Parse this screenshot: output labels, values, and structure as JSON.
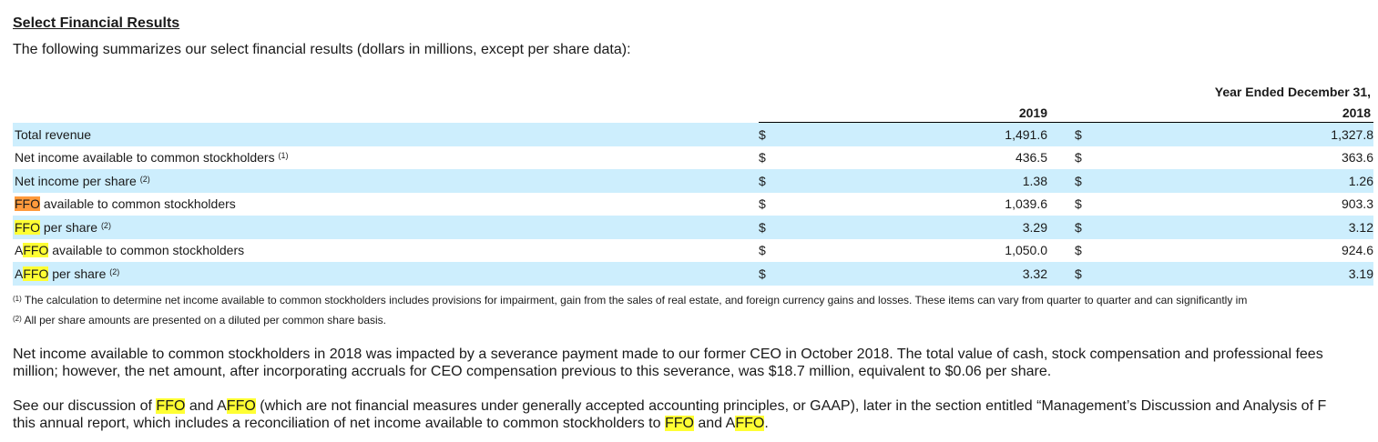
{
  "heading": "Select Financial Results",
  "intro": "The following summarizes our select financial results (dollars in millions, except per share data):",
  "table": {
    "period_header": "Year Ended December 31,",
    "years": [
      "2019",
      "2018"
    ],
    "rows": [
      {
        "pre": "",
        "hl": "",
        "post": "Total revenue",
        "sup": "",
        "cur1": "$",
        "v2019": "1,491.6",
        "cur2": "$",
        "v2018": "1,327.8"
      },
      {
        "pre": "",
        "hl": "",
        "post": "Net income available to common stockholders ",
        "sup": "(1)",
        "cur1": "$",
        "v2019": "436.5",
        "cur2": "$",
        "v2018": "363.6"
      },
      {
        "pre": "",
        "hl": "",
        "post": "Net income per share ",
        "sup": "(2)",
        "cur1": "$",
        "v2019": "1.38",
        "cur2": "$",
        "v2018": "1.26"
      },
      {
        "pre": "",
        "hl": "FFO",
        "post": " available to common stockholders",
        "sup": "",
        "cur1": "$",
        "v2019": "1,039.6",
        "cur2": "$",
        "v2018": "903.3"
      },
      {
        "pre": "",
        "hl": "FFO",
        "post": " per share ",
        "sup": "(2)",
        "cur1": "$",
        "v2019": "3.29",
        "cur2": "$",
        "v2018": "3.12"
      },
      {
        "pre": "A",
        "hl": "FFO",
        "post": " available to common stockholders",
        "sup": "",
        "cur1": "$",
        "v2019": "1,050.0",
        "cur2": "$",
        "v2018": "924.6"
      },
      {
        "pre": "A",
        "hl": "FFO",
        "post": " per share ",
        "sup": "(2)",
        "cur1": "$",
        "v2019": "3.32",
        "cur2": "$",
        "v2018": "3.19"
      }
    ]
  },
  "footnotes": [
    {
      "mark": "(1)",
      "text": " The calculation to determine net income available to common stockholders includes provisions for impairment, gain from the sales of real estate, and foreign currency gains and losses. These items can vary from quarter to quarter and can significantly im"
    },
    {
      "mark": "(2)",
      "text": " All per share amounts are presented on a diluted per common share basis."
    }
  ],
  "para1": {
    "line1": "Net income available to common stockholders in 2018 was impacted by a severance payment made to our former CEO in October 2018. The total value of cash, stock compensation and professional fees",
    "line2": "million; however, the net amount, after incorporating accruals for CEO compensation previous to this severance, was $18.7 million, equivalent to $0.06 per share."
  },
  "para2": {
    "l1_a": "See our discussion of ",
    "l1_ffo": "FFO",
    "l1_b": " and A",
    "l1_affo": "FFO",
    "l1_c": " (which are not financial measures under generally accepted accounting principles, or GAAP), later in the section entitled “Management’s Discussion and Analysis of F",
    "l2_a": "this annual report, which includes a reconciliation of net income available to common stockholders to ",
    "l2_ffo": "FFO",
    "l2_b": " and A",
    "l2_affo": "FFO",
    "l2_c": "."
  },
  "colors": {
    "row_shade": "#cdeefd",
    "highlight_yellow": "#ffff33",
    "highlight_orange": "#ff9a3c"
  }
}
